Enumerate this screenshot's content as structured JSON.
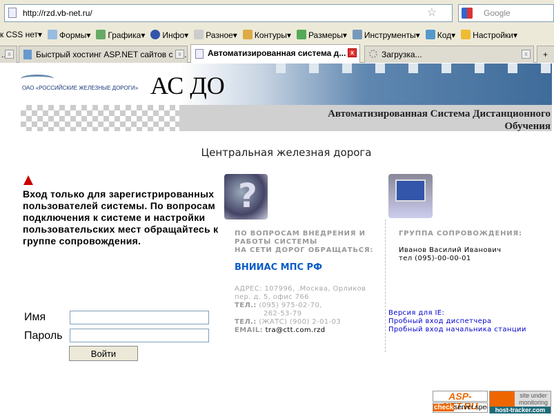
{
  "browser": {
    "url": "http://rzd.vb-net.ru/",
    "search_placeholder": "Google",
    "toolbar": [
      "к CSS нет▾",
      "Формы▾",
      "Графика▾",
      "Инфо▾",
      "Разное▾",
      "Контуры▾",
      "Размеры▾",
      "Инструменты▾",
      "Код▾",
      "Настройки▾"
    ],
    "tabs": [
      {
        "label": "..."
      },
      {
        "label": "Быстрый хостинг ASP.NET сайтов с и..."
      },
      {
        "label": "Автоматизированная система д..."
      },
      {
        "label": "Загрузка..."
      }
    ],
    "close_glyph": "x",
    "new_tab_glyph": "+"
  },
  "header": {
    "logo_text": "ОАО «РОССИЙСКИЕ ЖЕЛЕЗНЫЕ ДОРОГИ»",
    "title": "АС ДО",
    "subtitle_line1": "Автоматизированная Система Дистанционного",
    "subtitle_line2": "Обучения"
  },
  "railway": "Центральная железная дорога",
  "notice": "Вход только для зарегистрированных пользователей системы. По вопросам подключения к системе и настройки пользовательских мест обращайтесь к группе сопровождения.",
  "form": {
    "name_label": "Имя",
    "password_label": "Пароль",
    "name_value": "",
    "password_value": "",
    "submit": "Войти"
  },
  "contacts": {
    "heading1": "ПО ВОПРОСАМ ВНЕДРЕНИЯ И",
    "heading2": "РАБОТЫ СИСТЕМЫ",
    "heading3": "НА СЕТИ ДОРОГ ОБРАЩАТЬСЯ:",
    "org": "ВНИИАС МПС РФ",
    "address1": "АДРЕС: 107996, .Москва, Орликов",
    "address2": "пер. д. 5, офис 766",
    "tel_label": "ТЕЛ.:",
    "tel1": "(095) 975-02-70,",
    "tel1b": "262-53-79",
    "tel2": "(ЖАТС) (900) 2-01-03",
    "email_label": "EMAIL:",
    "email": "tra@ctt.com.rzd"
  },
  "support": {
    "heading": "ГРУППА СОПРОВОЖДЕНИЯ:",
    "name": "Иванов Василий Иванович",
    "phone": "тел (095)-00-00-01",
    "links": [
      "Версия для IE:",
      "Пробный вход диспетчера",
      "Пробный вход начальника станции"
    ]
  },
  "badges": {
    "aspnet": "ASP-NET.RU",
    "check": "check",
    "server_speed": "server speed",
    "monitor1": "site under",
    "monitor2": "monitoring",
    "tracker": "host-tracker.com"
  }
}
